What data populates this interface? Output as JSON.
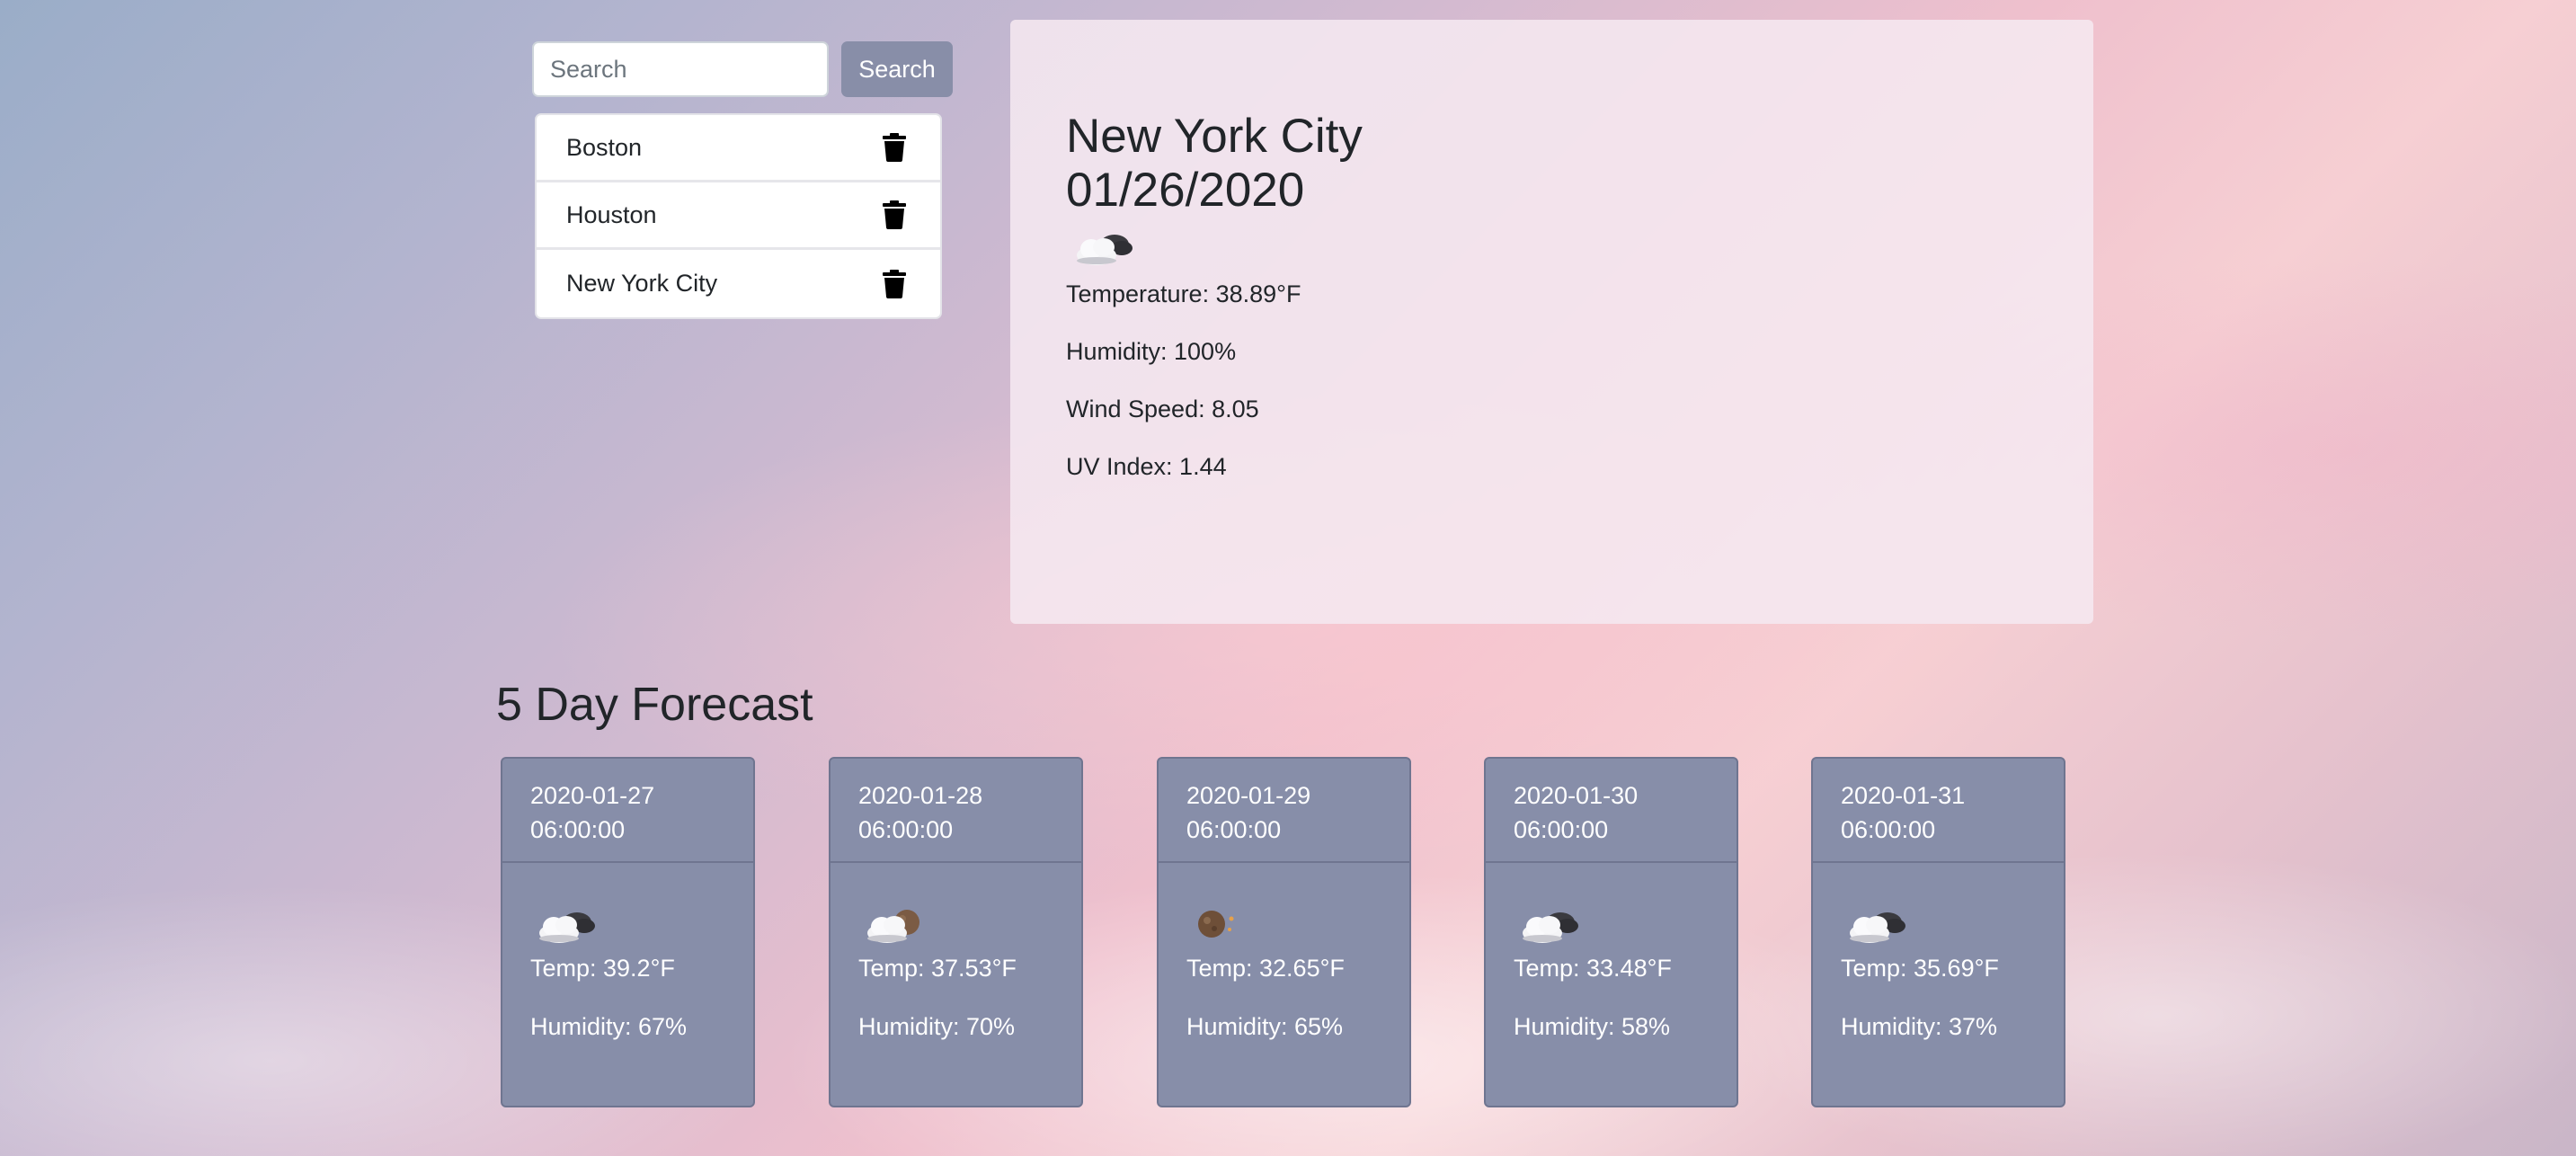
{
  "search": {
    "placeholder": "Search",
    "value": "",
    "button_label": "Search"
  },
  "history": [
    {
      "city": "Boston",
      "icon": "trash-icon"
    },
    {
      "city": "Houston",
      "icon": "trash-icon"
    },
    {
      "city": "New York City",
      "icon": "trash-icon"
    }
  ],
  "current": {
    "city": "New York City",
    "date": "01/26/2020",
    "icon": "cloud-night-icon",
    "temperature": "Temperature: 38.89°F",
    "humidity": "Humidity: 100%",
    "wind_speed": "Wind Speed: 8.05",
    "uv_index": "UV Index: 1.44"
  },
  "forecast": {
    "heading": "5 Day Forecast",
    "days": [
      {
        "date": "2020-01-27",
        "time": "06:00:00",
        "icon": "cloud-night-icon",
        "temp": "Temp: 39.2°F",
        "humidity": "Humidity: 67%"
      },
      {
        "date": "2020-01-28",
        "time": "06:00:00",
        "icon": "cloud-moon-icon",
        "temp": "Temp: 37.53°F",
        "humidity": "Humidity: 70%"
      },
      {
        "date": "2020-01-29",
        "time": "06:00:00",
        "icon": "moon-icon",
        "temp": "Temp: 32.65°F",
        "humidity": "Humidity: 65%"
      },
      {
        "date": "2020-01-30",
        "time": "06:00:00",
        "icon": "cloud-night-icon",
        "temp": "Temp: 33.48°F",
        "humidity": "Humidity: 58%"
      },
      {
        "date": "2020-01-31",
        "time": "06:00:00",
        "icon": "cloud-night-icon",
        "temp": "Temp: 35.69°F",
        "humidity": "Humidity: 37%"
      }
    ]
  },
  "colors": {
    "card": "#878ea9",
    "button": "#888ea8",
    "text": "#212529"
  }
}
